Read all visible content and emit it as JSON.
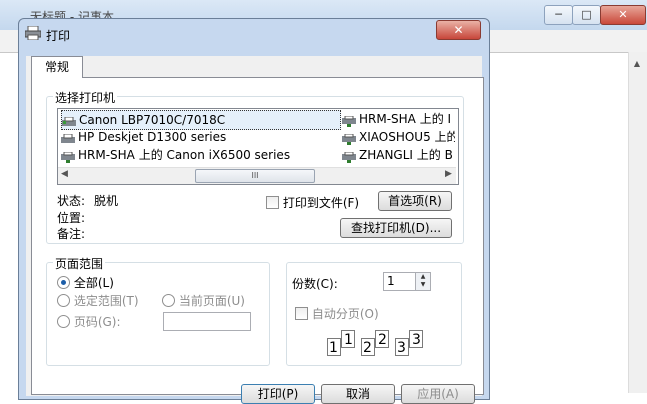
{
  "background": {
    "title": "无标题 - 记事本",
    "caption_buttons": {
      "minimize": "─",
      "maximize": "□",
      "close": "✕"
    }
  },
  "dialog": {
    "title": "打印",
    "close_glyph": "✕",
    "tabs": [
      {
        "label": "常规",
        "selected": true
      }
    ],
    "select_printer": {
      "label": "选择打印机",
      "printers": [
        "Canon LBP7010C/7018C",
        "HP Deskjet D1300 series",
        "HRM-SHA 上的 Canon iX6500 series",
        "HRM-SHA 上的 I",
        "XIAOSHOU5 上的",
        "ZHANGLI 上的 B"
      ],
      "selected_printer": "Canon LBP7010C/7018C",
      "scroll_thumb": "III",
      "status_label": "状态:",
      "status_value": "脱机",
      "location_label": "位置:",
      "location_value": "",
      "comment_label": "备注:",
      "comment_value": "",
      "print_to_file": "打印到文件(F)",
      "print_to_file_checked": false,
      "preferences_button": "首选项(R)",
      "find_printer_button": "查找打印机(D)..."
    },
    "page_range": {
      "label": "页面范围",
      "all": "全部(L)",
      "selection": "选定范围(T)",
      "current_page": "当前页面(U)",
      "pages": "页码(G):",
      "pages_value": "",
      "selected": "all"
    },
    "copies": {
      "label": "份数(C):",
      "value": "1",
      "collate": "自动分页(O)",
      "collate_checked": false,
      "collate_digits": [
        "1",
        "1",
        "2",
        "2",
        "3",
        "3"
      ]
    },
    "bottom_buttons": {
      "print": "打印(P)",
      "cancel": "取消",
      "apply": "应用(A)"
    },
    "colors": {
      "accent": "#1d5ea8",
      "title_bar": "#c6d8ef",
      "close_button": "#c7463a"
    }
  }
}
